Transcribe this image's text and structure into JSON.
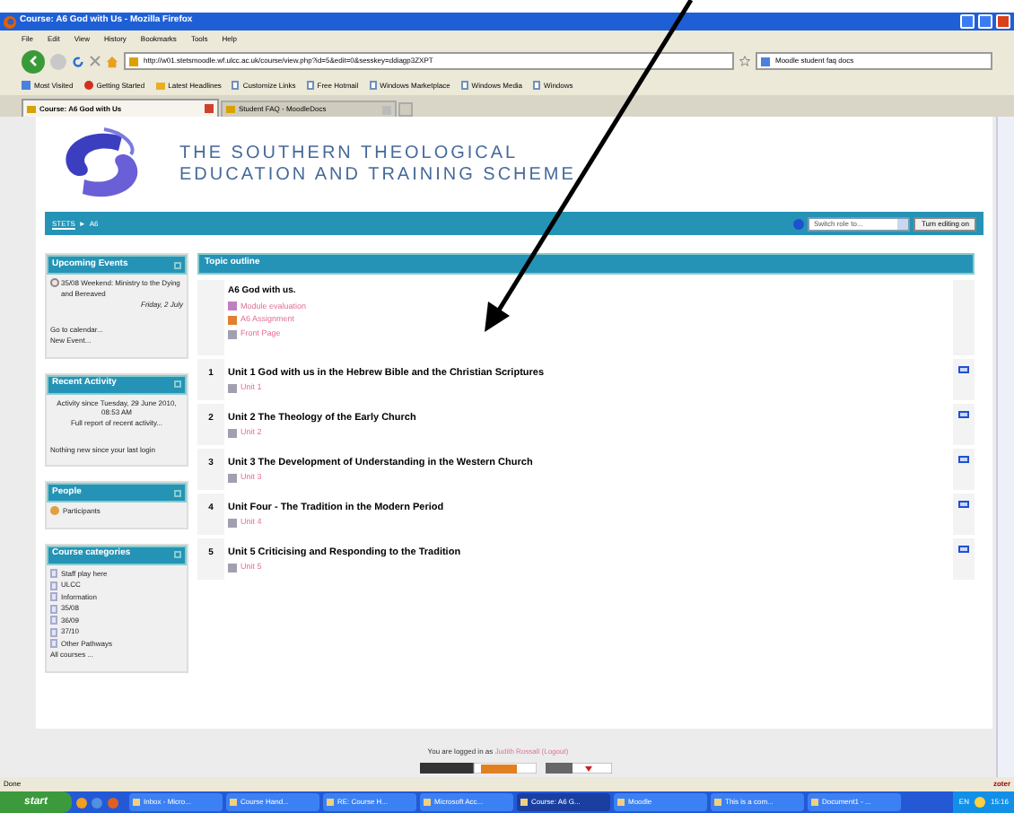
{
  "window": {
    "title": "Course: A6 God with Us - Mozilla Firefox"
  },
  "menu": [
    "File",
    "Edit",
    "View",
    "History",
    "Bookmarks",
    "Tools",
    "Help"
  ],
  "address": "http://w01.stetsmoodle.wf.ulcc.ac.uk/course/view.php?id=5&edit=0&sesskey=ddiagp3ZXPT",
  "search": "Moodle student faq docs",
  "bookmarks": [
    "Most Visited",
    "Getting Started",
    "Latest Headlines",
    "Customize Links",
    "Free Hotmail",
    "Windows Marketplace",
    "Windows Media",
    "Windows"
  ],
  "tabs": [
    {
      "label": "Course: A6 God with Us",
      "selected": true
    },
    {
      "label": "Student FAQ - MoodleDocs",
      "selected": false
    }
  ],
  "site_title": [
    "THE SOUTHERN THEOLOGICAL",
    "EDUCATION AND TRAINING SCHEME"
  ],
  "breadcrumb": {
    "home": "STETS",
    "separator": "►",
    "current": "A6"
  },
  "switch_role": "Switch role to...",
  "edit_button": "Turn editing on",
  "blocks": [
    {
      "title": "Upcoming Events",
      "lines": [
        {
          "kind": "event",
          "text": "35/08 Weekend: Ministry to the Dying and Bereaved"
        },
        {
          "kind": "date",
          "text": "Friday, 2 July"
        },
        {
          "kind": "gap"
        },
        {
          "kind": "link",
          "text": "Go to calendar..."
        },
        {
          "kind": "link",
          "text": "New Event..."
        }
      ]
    },
    {
      "title": "Recent Activity",
      "lines": [
        {
          "kind": "center",
          "text": "Activity since Tuesday, 29 June 2010, 08:53 AM"
        },
        {
          "kind": "center",
          "text": "Full report of recent activity..."
        },
        {
          "kind": "gap"
        },
        {
          "kind": "plain",
          "text": "Nothing new since your last login"
        }
      ]
    },
    {
      "title": "People",
      "lines": [
        {
          "kind": "people",
          "text": "Participants"
        }
      ]
    },
    {
      "title": "Course categories",
      "lines": [
        {
          "kind": "folder",
          "text": "Staff play here"
        },
        {
          "kind": "folder",
          "text": "ULCC"
        },
        {
          "kind": "folder",
          "text": "Information"
        },
        {
          "kind": "folder",
          "text": "35/08"
        },
        {
          "kind": "folder",
          "text": "36/09"
        },
        {
          "kind": "folder",
          "text": "37/10"
        },
        {
          "kind": "folder",
          "text": "Other Pathways"
        },
        {
          "kind": "link",
          "text": "All courses ..."
        }
      ]
    }
  ],
  "outline": {
    "title": "Topic outline",
    "intro": {
      "title": "A6 God with us.",
      "items": [
        {
          "kind": "quiz",
          "label": "Module evaluation"
        },
        {
          "kind": "assignment",
          "label": "A6 Assignment"
        },
        {
          "kind": "resource",
          "label": "Front Page"
        }
      ]
    },
    "sections": [
      {
        "number": "1",
        "title": "Unit 1 God with us in the Hebrew Bible and the Christian Scriptures",
        "resource": "Unit 1"
      },
      {
        "number": "2",
        "title": "Unit 2 The Theology of the Early Church",
        "resource": "Unit 2"
      },
      {
        "number": "3",
        "title": "Unit 3 The Development of Understanding in the Western Church",
        "resource": "Unit 3"
      },
      {
        "number": "4",
        "title": "Unit Four - The Tradition in the Modern Period",
        "resource": "Unit 4"
      },
      {
        "number": "5",
        "title": "Unit 5 Criticising and Responding to the Tradition",
        "resource": "Unit 5"
      }
    ]
  },
  "footer": {
    "prefix": "You are logged in as",
    "user": "Judith Rossall",
    "logout": "(Logout)"
  },
  "status_bar": {
    "text": "Done",
    "addon": "zoter"
  },
  "taskbar": {
    "start": "start",
    "items": [
      {
        "label": "Inbox - Micro...",
        "selected": false
      },
      {
        "label": "Course Hand...",
        "selected": false
      },
      {
        "label": "RE: Course H...",
        "selected": false
      },
      {
        "label": "Microsoft Acc...",
        "selected": false
      },
      {
        "label": "Course: A6 G...",
        "selected": true
      },
      {
        "label": "Moodle",
        "selected": false
      },
      {
        "label": "This is a com...",
        "selected": false
      },
      {
        "label": "Document1 - ...",
        "selected": false
      }
    ],
    "language": "EN",
    "clock": "15:16"
  }
}
